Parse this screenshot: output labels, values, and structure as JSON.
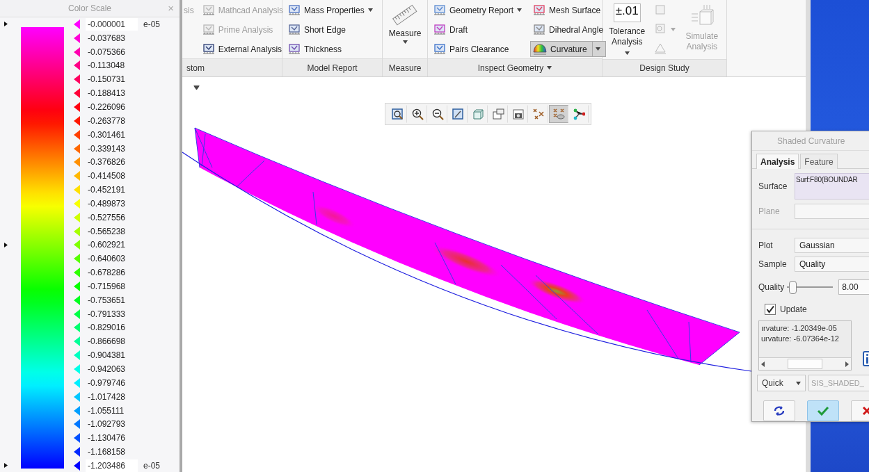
{
  "color_scale": {
    "title": "Color Scale",
    "close_label": "×",
    "levels": [
      {
        "value": "-0.000001",
        "color": "#ff00ff",
        "kind": "field",
        "exponent": "e-05",
        "pointer": true
      },
      {
        "value": "-0.037683",
        "color": "#ff00d7",
        "kind": "label",
        "pointer": false
      },
      {
        "value": "-0.075366",
        "color": "#ff00b0",
        "kind": "label",
        "pointer": false
      },
      {
        "value": "-0.113048",
        "color": "#ff0088",
        "kind": "label",
        "pointer": false
      },
      {
        "value": "-0.150731",
        "color": "#ff0060",
        "kind": "label",
        "pointer": false
      },
      {
        "value": "-0.188413",
        "color": "#ff0038",
        "kind": "label",
        "pointer": false
      },
      {
        "value": "-0.226096",
        "color": "#ff0010",
        "kind": "label",
        "pointer": false
      },
      {
        "value": "-0.263778",
        "color": "#ff1800",
        "kind": "label",
        "pointer": false
      },
      {
        "value": "-0.301461",
        "color": "#ff4000",
        "kind": "label",
        "pointer": false
      },
      {
        "value": "-0.339143",
        "color": "#ff6800",
        "kind": "label",
        "pointer": false
      },
      {
        "value": "-0.376826",
        "color": "#ff9000",
        "kind": "label",
        "pointer": false
      },
      {
        "value": "-0.414508",
        "color": "#ffb800",
        "kind": "label",
        "pointer": false
      },
      {
        "value": "-0.452191",
        "color": "#ffe000",
        "kind": "label",
        "pointer": false
      },
      {
        "value": "-0.489873",
        "color": "#f7ff00",
        "kind": "label",
        "pointer": false
      },
      {
        "value": "-0.527556",
        "color": "#cfff00",
        "kind": "label",
        "pointer": false
      },
      {
        "value": "-0.565238",
        "color": "#a7ff00",
        "kind": "label",
        "pointer": false
      },
      {
        "value": "-0.602921",
        "color": "#80ff00",
        "kind": "label",
        "pointer": true
      },
      {
        "value": "-0.640603",
        "color": "#58ff00",
        "kind": "label",
        "pointer": false
      },
      {
        "value": "-0.678286",
        "color": "#30ff00",
        "kind": "label",
        "pointer": false
      },
      {
        "value": "-0.715968",
        "color": "#08ff00",
        "kind": "label",
        "pointer": false
      },
      {
        "value": "-0.753651",
        "color": "#00ff20",
        "kind": "label",
        "pointer": false
      },
      {
        "value": "-0.791333",
        "color": "#00ff48",
        "kind": "label",
        "pointer": false
      },
      {
        "value": "-0.829016",
        "color": "#00ff70",
        "kind": "label",
        "pointer": false
      },
      {
        "value": "-0.866698",
        "color": "#00ff98",
        "kind": "label",
        "pointer": false
      },
      {
        "value": "-0.904381",
        "color": "#00ffc0",
        "kind": "label",
        "pointer": false
      },
      {
        "value": "-0.942063",
        "color": "#00ffe8",
        "kind": "label",
        "pointer": false
      },
      {
        "value": "-0.979746",
        "color": "#00efff",
        "kind": "label",
        "pointer": false
      },
      {
        "value": "-1.017428",
        "color": "#00c7ff",
        "kind": "label",
        "pointer": false
      },
      {
        "value": "-1.055111",
        "color": "#009fff",
        "kind": "label",
        "pointer": false
      },
      {
        "value": "-1.092793",
        "color": "#0078ff",
        "kind": "label",
        "pointer": false
      },
      {
        "value": "-1.130476",
        "color": "#0050ff",
        "kind": "label",
        "pointer": false
      },
      {
        "value": "-1.168158",
        "color": "#0028ff",
        "kind": "label",
        "pointer": false
      },
      {
        "value": "-1.203486",
        "color": "#0000ff",
        "kind": "field",
        "exponent": "e-05",
        "pointer": true
      }
    ]
  },
  "ribbon": {
    "groups": [
      {
        "label": "stom",
        "dropdown": false,
        "columns": [
          [
            {
              "kind": "text",
              "label": "sis",
              "disabled": true
            }
          ],
          [
            {
              "kind": "small",
              "label": "Mathcad Analysis",
              "disabled": true,
              "dropdown": false
            },
            {
              "kind": "small",
              "label": "Prime Analysis",
              "disabled": true,
              "dropdown": false
            },
            {
              "kind": "small",
              "label": "External Analysis",
              "disabled": false,
              "dropdown": false
            }
          ]
        ]
      },
      {
        "label": "Model Report",
        "dropdown": false,
        "columns": [
          [
            {
              "kind": "small",
              "label": "Mass Properties",
              "disabled": false,
              "dropdown": true
            },
            {
              "kind": "small",
              "label": "Short Edge",
              "disabled": false,
              "dropdown": false
            },
            {
              "kind": "small",
              "label": "Thickness",
              "disabled": false,
              "dropdown": false
            }
          ]
        ]
      },
      {
        "label": "Measure",
        "dropdown": false,
        "columns": [
          [
            {
              "kind": "large",
              "label": "Measure",
              "disabled": false,
              "dropdown": true
            }
          ]
        ]
      },
      {
        "label": "Inspect Geometry",
        "dropdown": true,
        "columns": [
          [
            {
              "kind": "small",
              "label": "Geometry Report",
              "disabled": false,
              "dropdown": true
            },
            {
              "kind": "small",
              "label": "Draft",
              "disabled": false,
              "dropdown": false
            },
            {
              "kind": "small",
              "label": "Pairs Clearance",
              "disabled": false,
              "dropdown": false
            }
          ],
          [
            {
              "kind": "small",
              "label": "Mesh Surface",
              "disabled": false,
              "dropdown": false
            },
            {
              "kind": "small",
              "label": "Dihedral Angle",
              "disabled": false,
              "dropdown": false
            },
            {
              "kind": "split",
              "label": "Curvature",
              "disabled": false,
              "selected": true
            }
          ]
        ]
      },
      {
        "label": "Design Study",
        "dropdown": false,
        "columns": [
          [
            {
              "kind": "large",
              "label": "Tolerance Analysis",
              "badge": "±.01",
              "disabled": false,
              "dropdown": true
            }
          ],
          [
            {
              "kind": "icon",
              "disabled": true,
              "dropdown": false
            },
            {
              "kind": "icon",
              "disabled": true,
              "dropdown": true
            },
            {
              "kind": "icon",
              "disabled": true,
              "dropdown": false
            }
          ],
          [
            {
              "kind": "large",
              "label": "Simulate Analysis",
              "disabled": true,
              "dropdown": false
            }
          ]
        ]
      }
    ]
  },
  "view_toolbar": {
    "tools": [
      {
        "selected": false
      },
      {
        "selected": false
      },
      {
        "selected": false
      },
      {
        "selected": false
      },
      {
        "selected": false
      },
      {
        "selected": false
      },
      {
        "selected": false
      },
      {
        "selected": false
      },
      {
        "selected": true
      },
      {
        "selected": false
      }
    ]
  },
  "dialog": {
    "title": "Shaded Curvature",
    "tabs": [
      {
        "label": "Analysis",
        "selected": true
      },
      {
        "label": "Feature",
        "selected": false
      }
    ],
    "surface": {
      "label": "Surface",
      "value": "Surf:F80(BOUNDAR"
    },
    "plane": {
      "label": "Plane",
      "disabled": true
    },
    "plot": {
      "label": "Plot",
      "value": "Gaussian"
    },
    "sample": {
      "label": "Sample",
      "value": "Quality"
    },
    "quality": {
      "label": "Quality",
      "level": 0.1,
      "value": "8.00"
    },
    "update": {
      "label": "Update",
      "checked": true
    },
    "results": [
      "ırvature: -1.20349e-05",
      "urvature: -6.07364e-12"
    ],
    "mode": {
      "value": "Quick"
    },
    "name": {
      "placeholder": "SIS_SHADED_"
    },
    "buttons": [
      {
        "kind": "repaint"
      },
      {
        "kind": "ok"
      },
      {
        "kind": "cancel"
      }
    ]
  }
}
